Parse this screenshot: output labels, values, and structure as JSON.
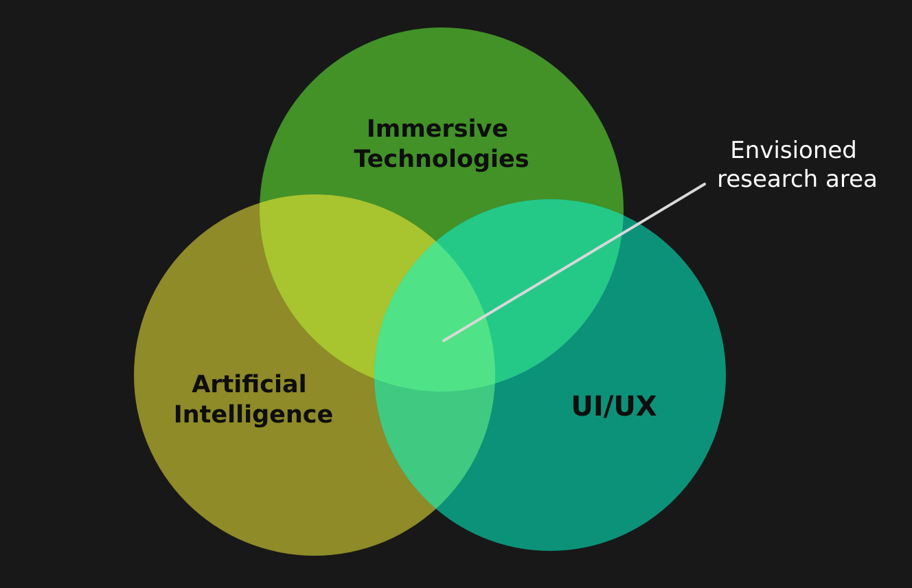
{
  "diagram": {
    "type": "venn",
    "background_color": "#181818",
    "sets": [
      {
        "id": "immersive",
        "label_lines": [
          "Immersive",
          "Technologies"
        ],
        "color": "#429227"
      },
      {
        "id": "ai",
        "label_lines": [
          "Artificial",
          "Intelligence"
        ],
        "color": "#8e8b28"
      },
      {
        "id": "uiux",
        "label_lines": [
          "UI/UX"
        ],
        "color": "#0c9279"
      }
    ],
    "overlaps": {
      "immersive_ai": "#a8c42e",
      "immersive_uiux": "#24c988",
      "ai_uiux": "#40c981",
      "center": "#4fe287"
    },
    "annotation": {
      "lines": [
        "Envisioned",
        "research area"
      ],
      "leader_color": "#d8d8d8",
      "text_color": "#ffffff"
    }
  }
}
